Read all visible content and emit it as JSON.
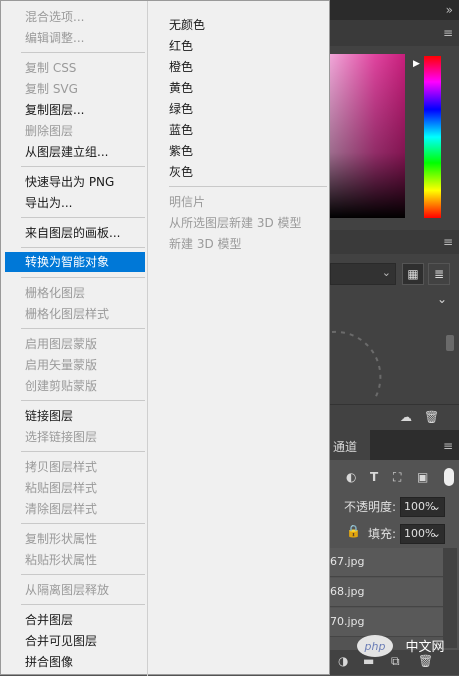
{
  "menu": {
    "items": [
      {
        "label": "混合选项...",
        "enabled": false
      },
      {
        "label": "编辑调整...",
        "enabled": false
      },
      {
        "label": "复制 CSS",
        "enabled": false
      },
      {
        "label": "复制 SVG",
        "enabled": false
      },
      {
        "label": "复制图层...",
        "enabled": true
      },
      {
        "label": "删除图层",
        "enabled": false
      },
      {
        "label": "从图层建立组...",
        "enabled": true
      },
      {
        "label": "快速导出为 PNG",
        "enabled": true
      },
      {
        "label": "导出为...",
        "enabled": true
      },
      {
        "label": "来自图层的画板...",
        "enabled": true
      },
      {
        "label": "转换为智能对象",
        "enabled": true,
        "selected": true
      },
      {
        "label": "栅格化图层",
        "enabled": false
      },
      {
        "label": "栅格化图层样式",
        "enabled": false
      },
      {
        "label": "启用图层蒙版",
        "enabled": false
      },
      {
        "label": "启用矢量蒙版",
        "enabled": false
      },
      {
        "label": "创建剪贴蒙版",
        "enabled": false
      },
      {
        "label": "链接图层",
        "enabled": true
      },
      {
        "label": "选择链接图层",
        "enabled": false
      },
      {
        "label": "拷贝图层样式",
        "enabled": false
      },
      {
        "label": "粘贴图层样式",
        "enabled": false
      },
      {
        "label": "清除图层样式",
        "enabled": false
      },
      {
        "label": "复制形状属性",
        "enabled": false
      },
      {
        "label": "粘贴形状属性",
        "enabled": false
      },
      {
        "label": "从隔离图层释放",
        "enabled": false
      },
      {
        "label": "合并图层",
        "enabled": true
      },
      {
        "label": "合并可见图层",
        "enabled": true
      },
      {
        "label": "拼合图像",
        "enabled": true
      }
    ],
    "colors_submenu": [
      {
        "label": "无颜色",
        "enabled": true
      },
      {
        "label": "红色",
        "enabled": true
      },
      {
        "label": "橙色",
        "enabled": true
      },
      {
        "label": "黄色",
        "enabled": true
      },
      {
        "label": "绿色",
        "enabled": true
      },
      {
        "label": "蓝色",
        "enabled": true
      },
      {
        "label": "紫色",
        "enabled": true
      },
      {
        "label": "灰色",
        "enabled": true
      },
      {
        "label": "明信片",
        "enabled": false
      },
      {
        "label": "从所选图层新建 3D 模型",
        "enabled": false
      },
      {
        "label": "新建 3D 模型",
        "enabled": false
      }
    ]
  },
  "panels": {
    "channels_tab": "通道",
    "opacity_label": "不透明度:",
    "opacity_value": "100%",
    "fill_label": "填充:",
    "fill_value": "100%",
    "layers": [
      "67.jpg",
      "68.jpg",
      "70.jpg"
    ],
    "watermark": "php 中文网",
    "collapse_icon": "double-chevron-right-icon",
    "panel_menu_icon": "hamburger-icon"
  },
  "colors": {
    "menu_bg": "#f0f0f0",
    "selection": "#0078d7",
    "disabled_text": "#9a9a9a",
    "panel_bg": "#535353"
  }
}
